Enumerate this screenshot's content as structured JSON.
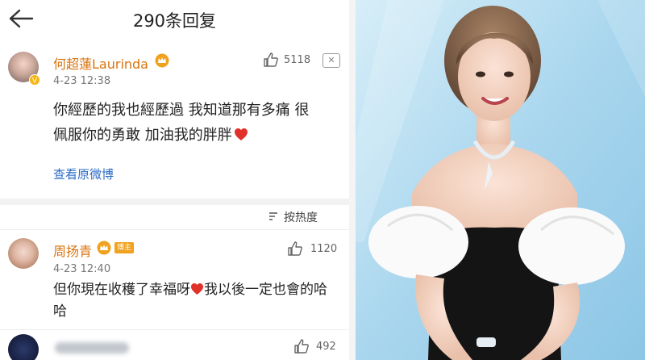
{
  "header": {
    "title": "290条回复"
  },
  "comments": [
    {
      "name": "何超蓮Laurinda",
      "time": "4-23 12:38",
      "likes": "5118",
      "text_line1": "你經歷的我也經歷過 我知道那有多痛 很",
      "text_line2": "佩服你的勇敢 加油我的胖胖",
      "view_original": "查看原微博"
    },
    {
      "name": "周扬青",
      "badge": "博主",
      "time": "4-23 12:40",
      "likes": "1120",
      "text_line1": "但你現在收穫了幸福呀",
      "text_line1_after": "我以後一定也會的哈",
      "text_line2": "哈"
    },
    {
      "likes": "492"
    }
  ],
  "sort": {
    "label": "按热度"
  },
  "colors": {
    "name": "#d9730d",
    "link": "#2c6cc6",
    "heart": "#e0312a"
  },
  "icons": [
    "back-arrow-icon",
    "thumbs-up-icon",
    "more-icon",
    "crown-icon",
    "heart-icon",
    "sort-icon"
  ]
}
